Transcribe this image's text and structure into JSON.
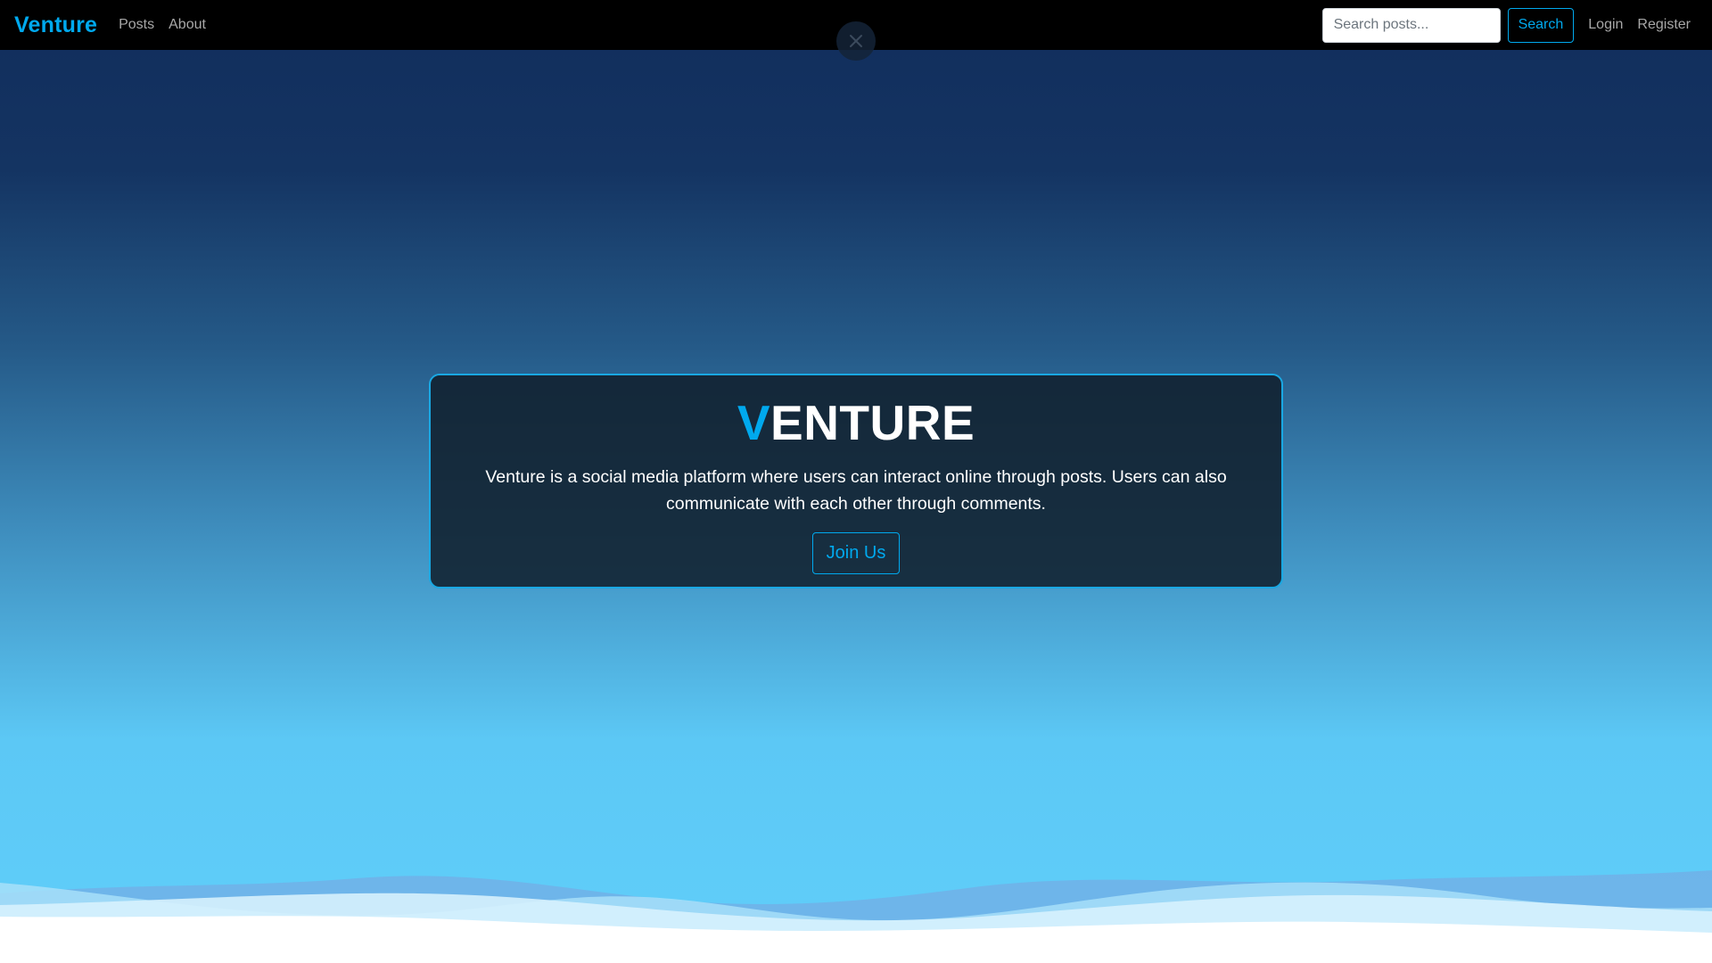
{
  "navbar": {
    "brand": "Venture",
    "links": [
      "Posts",
      "About"
    ],
    "search": {
      "placeholder": "Search posts...",
      "value": ""
    },
    "search_button": "Search",
    "login": "Login",
    "register": "Register"
  },
  "hero": {
    "title_first_letter": "V",
    "title_rest": "ENTURE",
    "description": "Venture is a social media platform where users can interact online through posts. Users can also communicate with each other through comments.",
    "cta_label": "Join Us"
  },
  "colors": {
    "accent": "#00a9ee",
    "navbar_bg": "#000000",
    "card_border": "#19a8e3",
    "card_bg": "#11202e",
    "gradient_top": "#112d5c",
    "gradient_bottom": "#60cefa"
  },
  "icons": {
    "close": "close-icon"
  }
}
